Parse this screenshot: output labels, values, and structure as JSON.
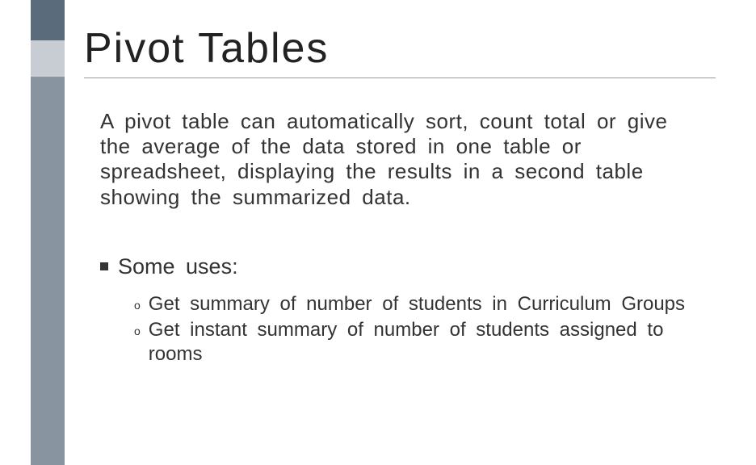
{
  "slide": {
    "title": "Pivot Tables",
    "paragraph": "A pivot table can automatically sort, count total or give the average of the data stored in one table or spreadsheet, displaying the results in a second table showing the summarized data.",
    "section_heading": "Some uses:",
    "sublist": [
      "Get summary of number of students in Curriculum Groups",
      "Get instant summary of number of students assigned to rooms"
    ]
  }
}
